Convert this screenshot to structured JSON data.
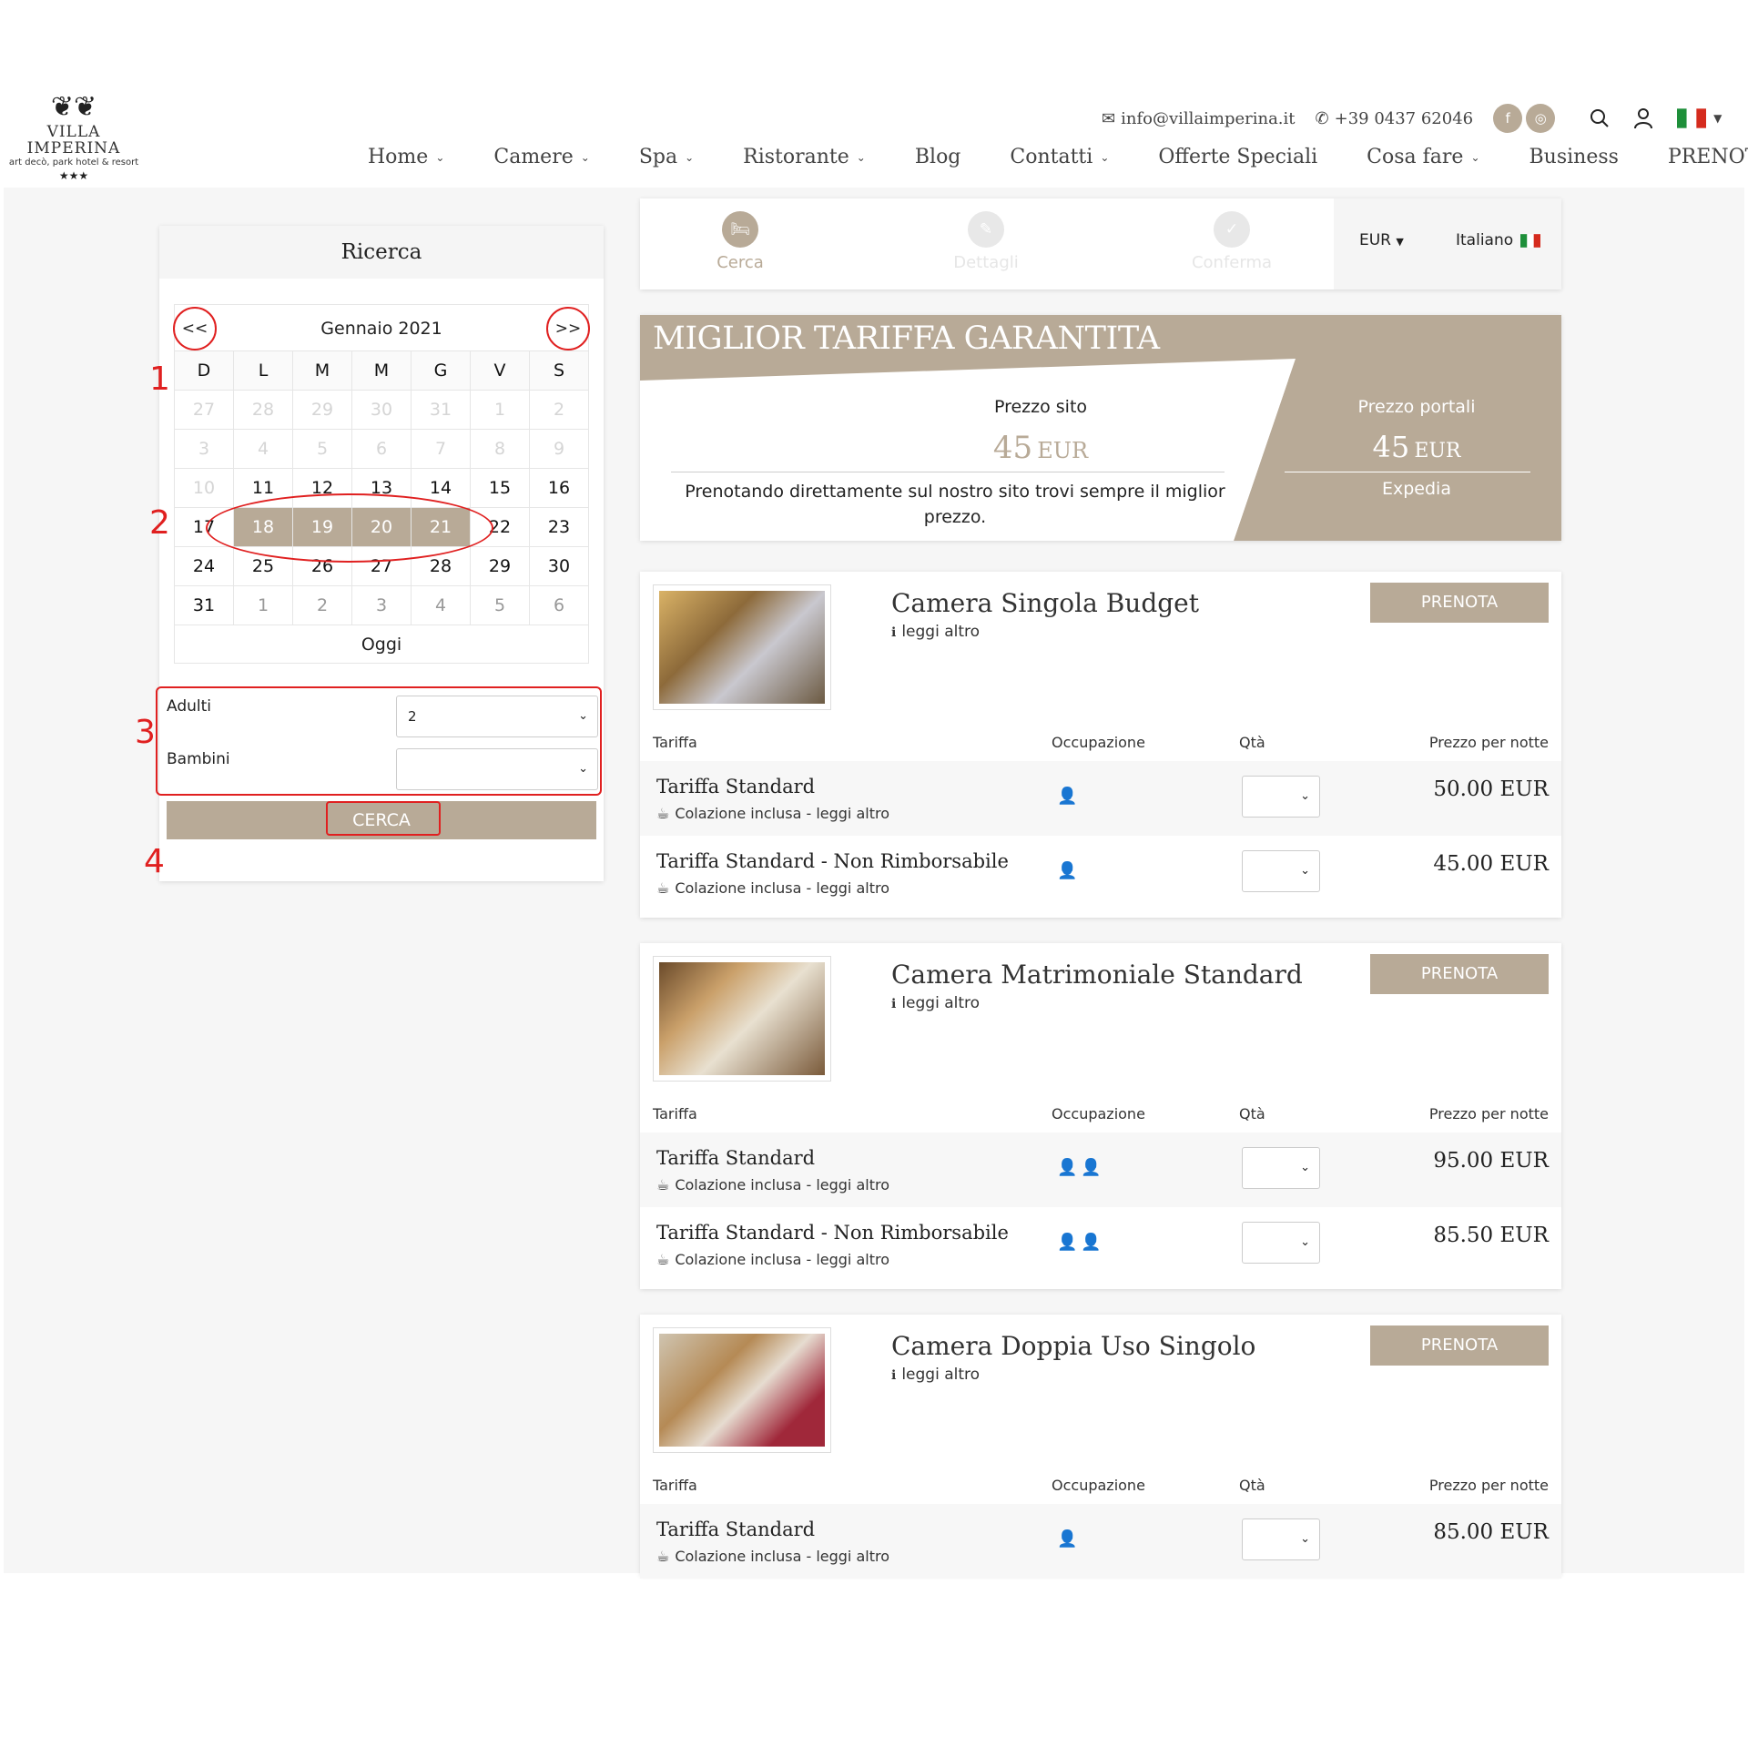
{
  "header": {
    "logo": {
      "name": "VILLA IMPERINA",
      "subtitle": "art decò, park hotel & resort",
      "stars": "★★★"
    },
    "email": "info@villaimperina.it",
    "phone": "+39 0437 62046",
    "nav": [
      {
        "label": "Home",
        "dropdown": true
      },
      {
        "label": "Camere",
        "dropdown": true
      },
      {
        "label": "Spa",
        "dropdown": true
      },
      {
        "label": "Ristorante",
        "dropdown": true
      },
      {
        "label": "Blog",
        "dropdown": false
      },
      {
        "label": "Contatti",
        "dropdown": true
      },
      {
        "label": "Offerte Speciali",
        "dropdown": false
      },
      {
        "label": "Cosa fare",
        "dropdown": true
      },
      {
        "label": "Business",
        "dropdown": false
      },
      {
        "label": "PRENOTA",
        "dropdown": false
      }
    ]
  },
  "search": {
    "title": "Ricerca",
    "calendar": {
      "month_label": "Gennaio 2021",
      "prev_label": "<<",
      "next_label": ">>",
      "weekdays": [
        "D",
        "L",
        "M",
        "M",
        "G",
        "V",
        "S"
      ],
      "weeks": [
        [
          "27",
          "28",
          "29",
          "30",
          "31",
          "1",
          "2"
        ],
        [
          "3",
          "4",
          "5",
          "6",
          "7",
          "8",
          "9"
        ],
        [
          "10",
          "11",
          "12",
          "13",
          "14",
          "15",
          "16"
        ],
        [
          "17",
          "18",
          "19",
          "20",
          "21",
          "22",
          "23"
        ],
        [
          "24",
          "25",
          "26",
          "27",
          "28",
          "29",
          "30"
        ],
        [
          "31",
          "1",
          "2",
          "3",
          "4",
          "5",
          "6"
        ]
      ],
      "today_label": "Oggi"
    },
    "adults_label": "Adulti",
    "adults_value": "2",
    "children_label": "Bambini",
    "children_value": "",
    "search_button": "CERCA"
  },
  "annotations": [
    "1",
    "2",
    "3",
    "4"
  ],
  "steps": [
    {
      "label": "Cerca",
      "active": true
    },
    {
      "label": "Dettagli",
      "active": false
    },
    {
      "label": "Conferma",
      "active": false
    }
  ],
  "currency": "EUR",
  "language": "Italiano",
  "banner": {
    "title": "MIGLIOR TARIFFA GARANTITA",
    "site_label": "Prezzo sito",
    "site_price": "45",
    "site_currency": "EUR",
    "site_note": "Prenotando direttamente sul nostro sito trovi sempre il miglior prezzo.",
    "portal_label": "Prezzo portali",
    "portal_price": "45",
    "portal_currency": "EUR",
    "portal_name": "Expedia"
  },
  "table_headers": {
    "rate": "Tariffa",
    "occupancy": "Occupazione",
    "qty": "Qtà",
    "price": "Prezzo per notte"
  },
  "book_label": "PRENOTA",
  "more_label": "leggi altro",
  "rooms": [
    {
      "title": "Camera Singola Budget",
      "rates": [
        {
          "name": "Tariffa Standard",
          "includes": "Colazione inclusa - leggi altro",
          "guests": 1,
          "price": "50.00 EUR"
        },
        {
          "name": "Tariffa Standard - Non Rimborsabile",
          "includes": "Colazione inclusa - leggi altro",
          "guests": 1,
          "price": "45.00 EUR"
        }
      ]
    },
    {
      "title": "Camera Matrimoniale Standard",
      "rates": [
        {
          "name": "Tariffa Standard",
          "includes": "Colazione inclusa - leggi altro",
          "guests": 2,
          "price": "95.00 EUR"
        },
        {
          "name": "Tariffa Standard - Non Rimborsabile",
          "includes": "Colazione inclusa - leggi altro",
          "guests": 2,
          "price": "85.50 EUR"
        }
      ]
    },
    {
      "title": "Camera Doppia Uso Singolo",
      "rates": [
        {
          "name": "Tariffa Standard",
          "includes": "Colazione inclusa - leggi altro",
          "guests": 1,
          "price": "85.00 EUR"
        }
      ]
    }
  ],
  "colors": {
    "accent": "#b8aa97",
    "annotation": "#e02020",
    "background": "#f6f6f6"
  }
}
